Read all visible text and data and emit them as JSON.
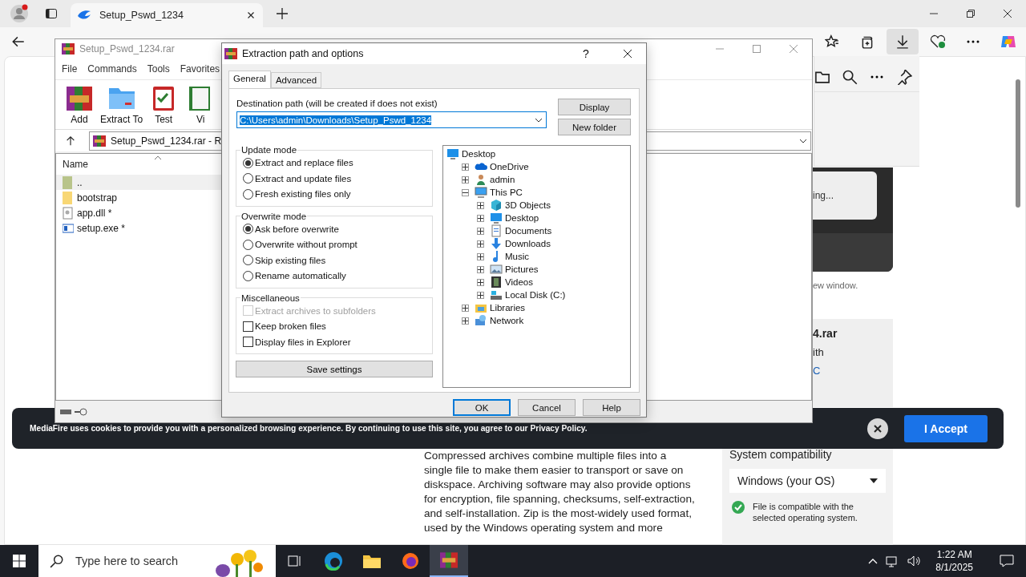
{
  "browser": {
    "tab": {
      "title": "Setup_Pswd_1234"
    }
  },
  "page": {
    "loading_button": "ing...",
    "note": "ew window.",
    "file_card": {
      "name": "4.rar",
      "line_2": "ith",
      "link": "C"
    },
    "cookie_banner": {
      "text": "MediaFire uses cookies to provide you with a personalized browsing experience. By continuing to use this site, you agree to our Privacy Policy.",
      "button": "I Accept"
    },
    "article": {
      "paragraph": "Compressed archives combine multiple files into a\nsingle file to make them easier to transport or save on\ndiskspace. Archiving software may also provide options\nfor encryption, file spanning, checksums, self-extraction,\nand self-installation. Zip is the most-widely used format,\nused by the Windows operating system and more"
    },
    "compatibility": {
      "title": "System compatibility",
      "select": "Windows (your OS)",
      "note": "File is compatible with the\nselected operating system."
    }
  },
  "winrar": {
    "title": "Setup_Pswd_1234.rar",
    "menu": [
      "File",
      "Commands",
      "Tools",
      "Favorites"
    ],
    "toolbar": [
      {
        "label": "Add",
        "kind": "add"
      },
      {
        "label": "Extract To",
        "kind": "extract"
      },
      {
        "label": "Test",
        "kind": "test"
      },
      {
        "label": "Vi",
        "kind": "view"
      }
    ],
    "address": "Setup_Pswd_1234.rar - R",
    "columns": [
      "Name"
    ],
    "files": [
      {
        "name": "..",
        "kind": "parent",
        "selected": true
      },
      {
        "name": "bootstrap",
        "kind": "folder",
        "selected": false
      },
      {
        "name": "app.dll *",
        "kind": "file",
        "selected": false
      },
      {
        "name": "setup.exe *",
        "kind": "exe",
        "selected": false
      }
    ]
  },
  "dialog": {
    "title": "Extraction path and options",
    "help": "?",
    "tabs": [
      {
        "label": "General",
        "selected": true
      },
      {
        "label": "Advanced",
        "selected": false
      }
    ],
    "destination_label": "Destination path (will be created if does not exist)",
    "destination": "C:\\Users\\admin\\Downloads\\Setup_Pswd_1234",
    "side_buttons": [
      "Display",
      "New folder"
    ],
    "update_mode": {
      "title": "Update mode",
      "options": [
        {
          "label": "Extract and replace files",
          "selected": true
        },
        {
          "label": "Extract and update files",
          "selected": false
        },
        {
          "label": "Fresh existing files only",
          "selected": false
        }
      ]
    },
    "overwrite_mode": {
      "title": "Overwrite mode",
      "options": [
        {
          "label": "Ask before overwrite",
          "selected": true
        },
        {
          "label": "Overwrite without prompt",
          "selected": false
        },
        {
          "label": "Skip existing files",
          "selected": false
        },
        {
          "label": "Rename automatically",
          "selected": false
        }
      ]
    },
    "miscellaneous": {
      "title": "Miscellaneous",
      "options": [
        {
          "label": "Extract archives to subfolders",
          "checked": false,
          "disabled": true
        },
        {
          "label": "Keep broken files",
          "checked": false,
          "disabled": false
        },
        {
          "label": "Display files in Explorer",
          "checked": false,
          "disabled": false
        }
      ]
    },
    "save_button": "Save settings",
    "tree": [
      {
        "label": "Desktop",
        "kind": "desktop",
        "children": [
          {
            "label": "OneDrive",
            "kind": "cloud",
            "expanded": false
          },
          {
            "label": "admin",
            "kind": "user",
            "expanded": false
          },
          {
            "label": "This PC",
            "kind": "computer",
            "expanded": true,
            "children": [
              {
                "label": "3D Objects",
                "kind": "cube",
                "expanded": false
              },
              {
                "label": "Desktop",
                "kind": "desktop",
                "expanded": false
              },
              {
                "label": "Documents",
                "kind": "documents",
                "expanded": false
              },
              {
                "label": "Downloads",
                "kind": "download",
                "expanded": false
              },
              {
                "label": "Music",
                "kind": "music",
                "expanded": false
              },
              {
                "label": "Pictures",
                "kind": "pictures",
                "expanded": false
              },
              {
                "label": "Videos",
                "kind": "videos",
                "expanded": false
              },
              {
                "label": "Local Disk (C:)",
                "kind": "disk",
                "expanded": false
              }
            ]
          },
          {
            "label": "Libraries",
            "kind": "libraries",
            "expanded": false
          },
          {
            "label": "Network",
            "kind": "network",
            "expanded": false
          }
        ]
      }
    ],
    "buttons": [
      {
        "label": "OK",
        "default": true
      },
      {
        "label": "Cancel",
        "default": false
      },
      {
        "label": "Help",
        "default": false
      }
    ]
  },
  "taskbar": {
    "search_placeholder": "Type here to search",
    "time": "1:22 AM",
    "date": "8/1/2025"
  }
}
